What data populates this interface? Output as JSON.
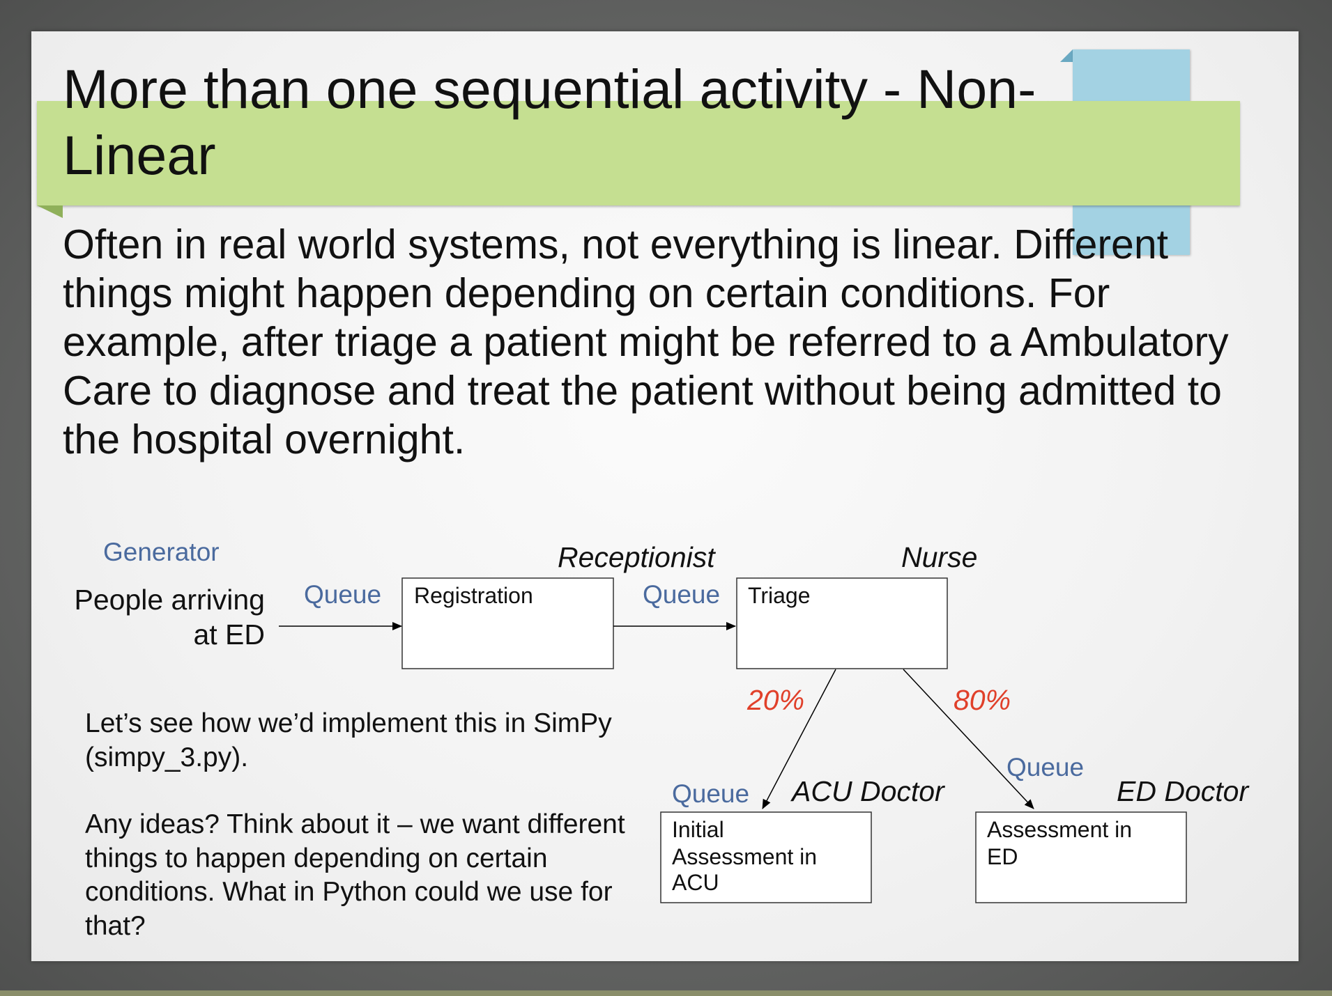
{
  "slide": {
    "title": "More than one sequential activity - Non-Linear",
    "body": "Often in real world systems, not everything is linear.  Different things might happen depending on certain conditions.  For example, after triage a patient might be referred to a Ambulatory Care to diagnose and treat the patient without being admitted to the hospital overnight.",
    "note_1": "Let’s see how we’d implement this in SimPy (simpy_3.py).",
    "note_2": "Any ideas?  Think about it – we want different things to happen depending on certain conditions.  What in Python could we use for that?"
  },
  "diagram": {
    "generator_label": "Generator",
    "source_line1": "People arriving",
    "source_line2": "at ED",
    "queue_label": "Queue",
    "registration": {
      "label": "Registration",
      "role": "Receptionist"
    },
    "triage": {
      "label": "Triage",
      "role": "Nurse"
    },
    "branch_left_pct": "20%",
    "branch_right_pct": "80%",
    "acu": {
      "line1": "Initial",
      "line2": "Assessment in",
      "line3": "ACU",
      "role": "ACU Doctor"
    },
    "ed": {
      "line1": "Assessment in",
      "line2": "ED",
      "role": "ED Doctor"
    }
  },
  "colors": {
    "title_band": "#c5df91",
    "accent_block": "#a3d2e3",
    "blue_label": "#4a6a9e",
    "percent_red": "#e0402a"
  }
}
